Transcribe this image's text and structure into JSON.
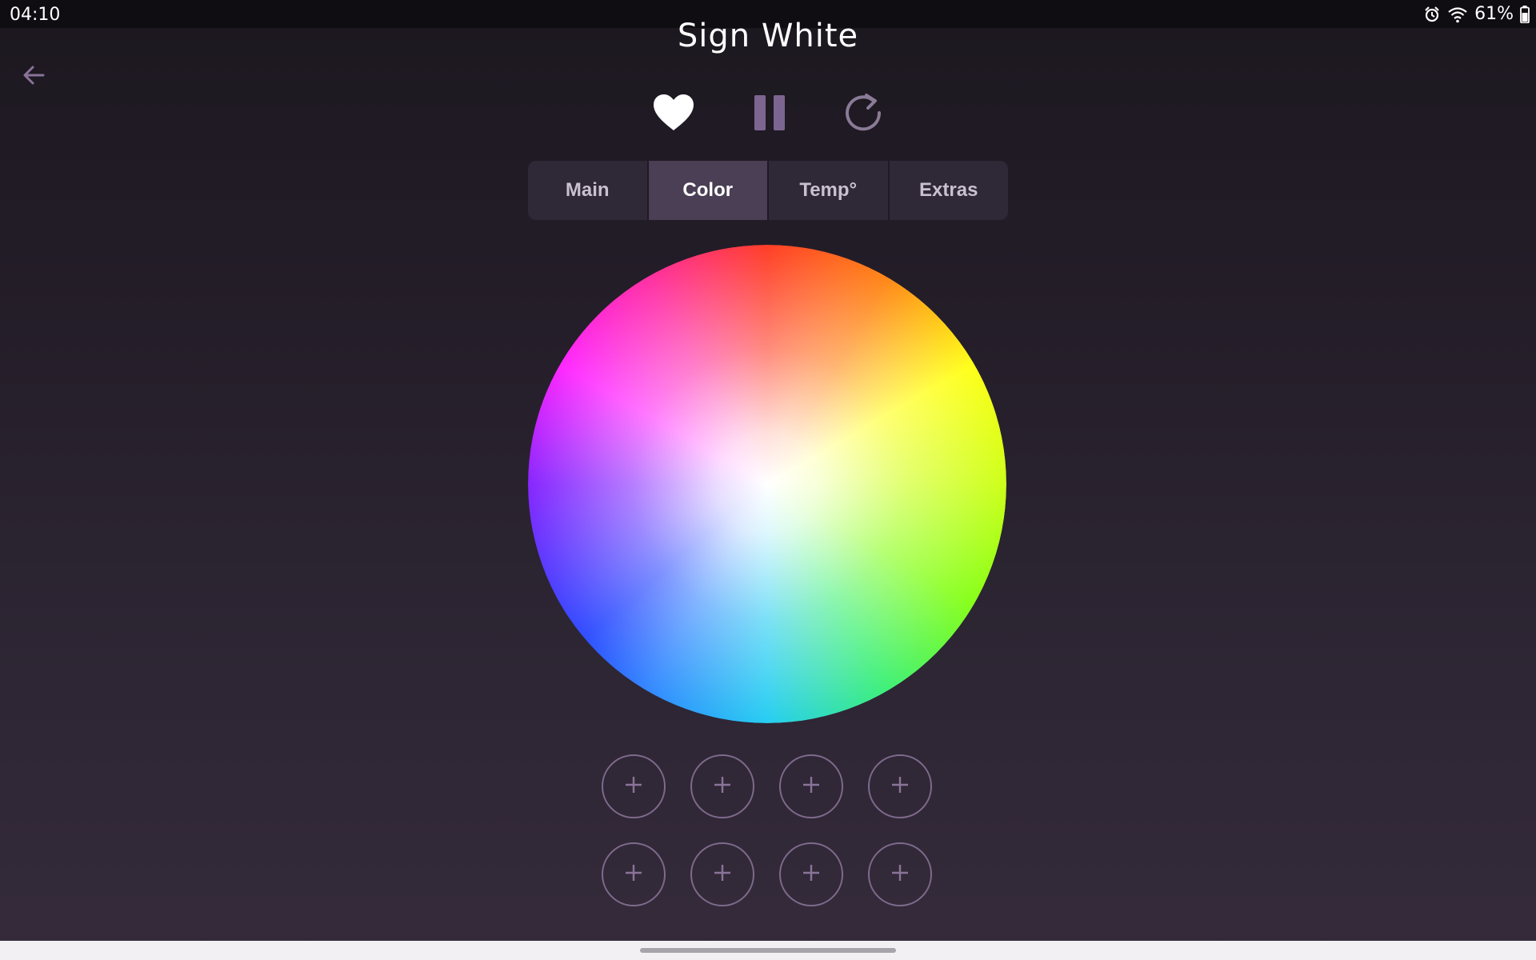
{
  "status_bar": {
    "time": "04:10",
    "battery": "61%",
    "icons": [
      "alarm-icon",
      "wifi-icon",
      "battery-icon"
    ]
  },
  "header": {
    "title": "Sign White",
    "back_icon": "arrow-left-icon"
  },
  "controls": {
    "favorite_icon": "heart-icon",
    "pause_icon": "pause-icon",
    "refresh_icon": "refresh-icon"
  },
  "tabs": [
    {
      "label": "Main",
      "active": false
    },
    {
      "label": "Color",
      "active": true
    },
    {
      "label": "Temp°",
      "active": false
    },
    {
      "label": "Extras",
      "active": false
    }
  ],
  "presets": {
    "count": 8,
    "icon": "plus-icon"
  },
  "colors": {
    "accent": "#7e6a8c",
    "active_tab": "#4a3f55",
    "tab_bg": "#2f2836"
  }
}
